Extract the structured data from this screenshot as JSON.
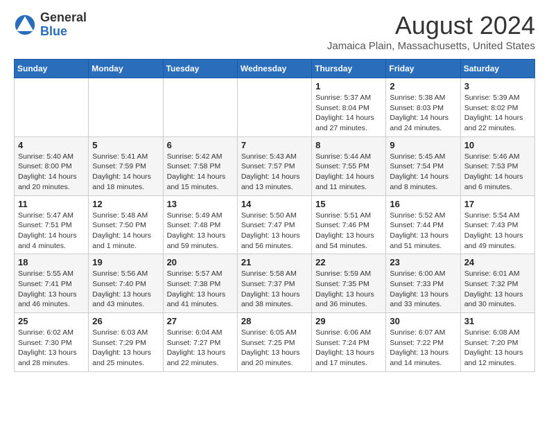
{
  "header": {
    "logo_line1": "General",
    "logo_line2": "Blue",
    "month_title": "August 2024",
    "location": "Jamaica Plain, Massachusetts, United States"
  },
  "days_of_week": [
    "Sunday",
    "Monday",
    "Tuesday",
    "Wednesday",
    "Thursday",
    "Friday",
    "Saturday"
  ],
  "weeks": [
    [
      {
        "day": "",
        "info": ""
      },
      {
        "day": "",
        "info": ""
      },
      {
        "day": "",
        "info": ""
      },
      {
        "day": "",
        "info": ""
      },
      {
        "day": "1",
        "info": "Sunrise: 5:37 AM\nSunset: 8:04 PM\nDaylight: 14 hours and 27 minutes."
      },
      {
        "day": "2",
        "info": "Sunrise: 5:38 AM\nSunset: 8:03 PM\nDaylight: 14 hours and 24 minutes."
      },
      {
        "day": "3",
        "info": "Sunrise: 5:39 AM\nSunset: 8:02 PM\nDaylight: 14 hours and 22 minutes."
      }
    ],
    [
      {
        "day": "4",
        "info": "Sunrise: 5:40 AM\nSunset: 8:00 PM\nDaylight: 14 hours and 20 minutes."
      },
      {
        "day": "5",
        "info": "Sunrise: 5:41 AM\nSunset: 7:59 PM\nDaylight: 14 hours and 18 minutes."
      },
      {
        "day": "6",
        "info": "Sunrise: 5:42 AM\nSunset: 7:58 PM\nDaylight: 14 hours and 15 minutes."
      },
      {
        "day": "7",
        "info": "Sunrise: 5:43 AM\nSunset: 7:57 PM\nDaylight: 14 hours and 13 minutes."
      },
      {
        "day": "8",
        "info": "Sunrise: 5:44 AM\nSunset: 7:55 PM\nDaylight: 14 hours and 11 minutes."
      },
      {
        "day": "9",
        "info": "Sunrise: 5:45 AM\nSunset: 7:54 PM\nDaylight: 14 hours and 8 minutes."
      },
      {
        "day": "10",
        "info": "Sunrise: 5:46 AM\nSunset: 7:53 PM\nDaylight: 14 hours and 6 minutes."
      }
    ],
    [
      {
        "day": "11",
        "info": "Sunrise: 5:47 AM\nSunset: 7:51 PM\nDaylight: 14 hours and 4 minutes."
      },
      {
        "day": "12",
        "info": "Sunrise: 5:48 AM\nSunset: 7:50 PM\nDaylight: 14 hours and 1 minute."
      },
      {
        "day": "13",
        "info": "Sunrise: 5:49 AM\nSunset: 7:48 PM\nDaylight: 13 hours and 59 minutes."
      },
      {
        "day": "14",
        "info": "Sunrise: 5:50 AM\nSunset: 7:47 PM\nDaylight: 13 hours and 56 minutes."
      },
      {
        "day": "15",
        "info": "Sunrise: 5:51 AM\nSunset: 7:46 PM\nDaylight: 13 hours and 54 minutes."
      },
      {
        "day": "16",
        "info": "Sunrise: 5:52 AM\nSunset: 7:44 PM\nDaylight: 13 hours and 51 minutes."
      },
      {
        "day": "17",
        "info": "Sunrise: 5:54 AM\nSunset: 7:43 PM\nDaylight: 13 hours and 49 minutes."
      }
    ],
    [
      {
        "day": "18",
        "info": "Sunrise: 5:55 AM\nSunset: 7:41 PM\nDaylight: 13 hours and 46 minutes."
      },
      {
        "day": "19",
        "info": "Sunrise: 5:56 AM\nSunset: 7:40 PM\nDaylight: 13 hours and 43 minutes."
      },
      {
        "day": "20",
        "info": "Sunrise: 5:57 AM\nSunset: 7:38 PM\nDaylight: 13 hours and 41 minutes."
      },
      {
        "day": "21",
        "info": "Sunrise: 5:58 AM\nSunset: 7:37 PM\nDaylight: 13 hours and 38 minutes."
      },
      {
        "day": "22",
        "info": "Sunrise: 5:59 AM\nSunset: 7:35 PM\nDaylight: 13 hours and 36 minutes."
      },
      {
        "day": "23",
        "info": "Sunrise: 6:00 AM\nSunset: 7:33 PM\nDaylight: 13 hours and 33 minutes."
      },
      {
        "day": "24",
        "info": "Sunrise: 6:01 AM\nSunset: 7:32 PM\nDaylight: 13 hours and 30 minutes."
      }
    ],
    [
      {
        "day": "25",
        "info": "Sunrise: 6:02 AM\nSunset: 7:30 PM\nDaylight: 13 hours and 28 minutes."
      },
      {
        "day": "26",
        "info": "Sunrise: 6:03 AM\nSunset: 7:29 PM\nDaylight: 13 hours and 25 minutes."
      },
      {
        "day": "27",
        "info": "Sunrise: 6:04 AM\nSunset: 7:27 PM\nDaylight: 13 hours and 22 minutes."
      },
      {
        "day": "28",
        "info": "Sunrise: 6:05 AM\nSunset: 7:25 PM\nDaylight: 13 hours and 20 minutes."
      },
      {
        "day": "29",
        "info": "Sunrise: 6:06 AM\nSunset: 7:24 PM\nDaylight: 13 hours and 17 minutes."
      },
      {
        "day": "30",
        "info": "Sunrise: 6:07 AM\nSunset: 7:22 PM\nDaylight: 13 hours and 14 minutes."
      },
      {
        "day": "31",
        "info": "Sunrise: 6:08 AM\nSunset: 7:20 PM\nDaylight: 13 hours and 12 minutes."
      }
    ]
  ]
}
